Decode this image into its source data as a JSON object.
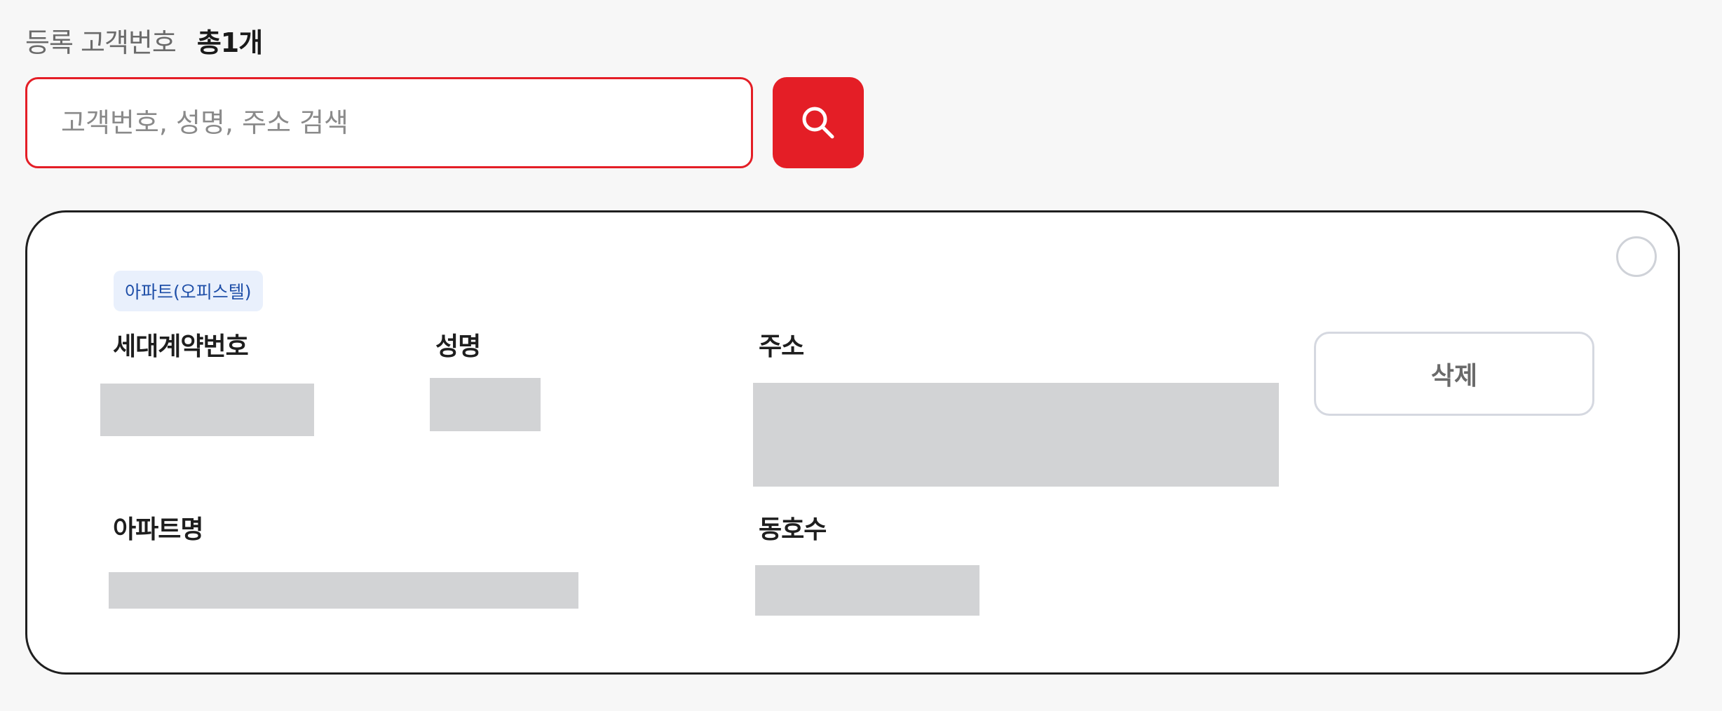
{
  "header": {
    "label": "등록 고객번호",
    "count": "총1개"
  },
  "search": {
    "placeholder": "고객번호, 성명, 주소 검색",
    "value": "",
    "button_icon": "search-icon",
    "accent_color": "#e41e26"
  },
  "customers": [
    {
      "type_badge": "아파트(오피스텔)",
      "fields": {
        "contract_no_label": "세대계약번호",
        "name_label": "성명",
        "address_label": "주소",
        "apt_name_label": "아파트명",
        "unit_label": "동호수"
      },
      "delete_label": "삭제",
      "selected": false
    }
  ]
}
